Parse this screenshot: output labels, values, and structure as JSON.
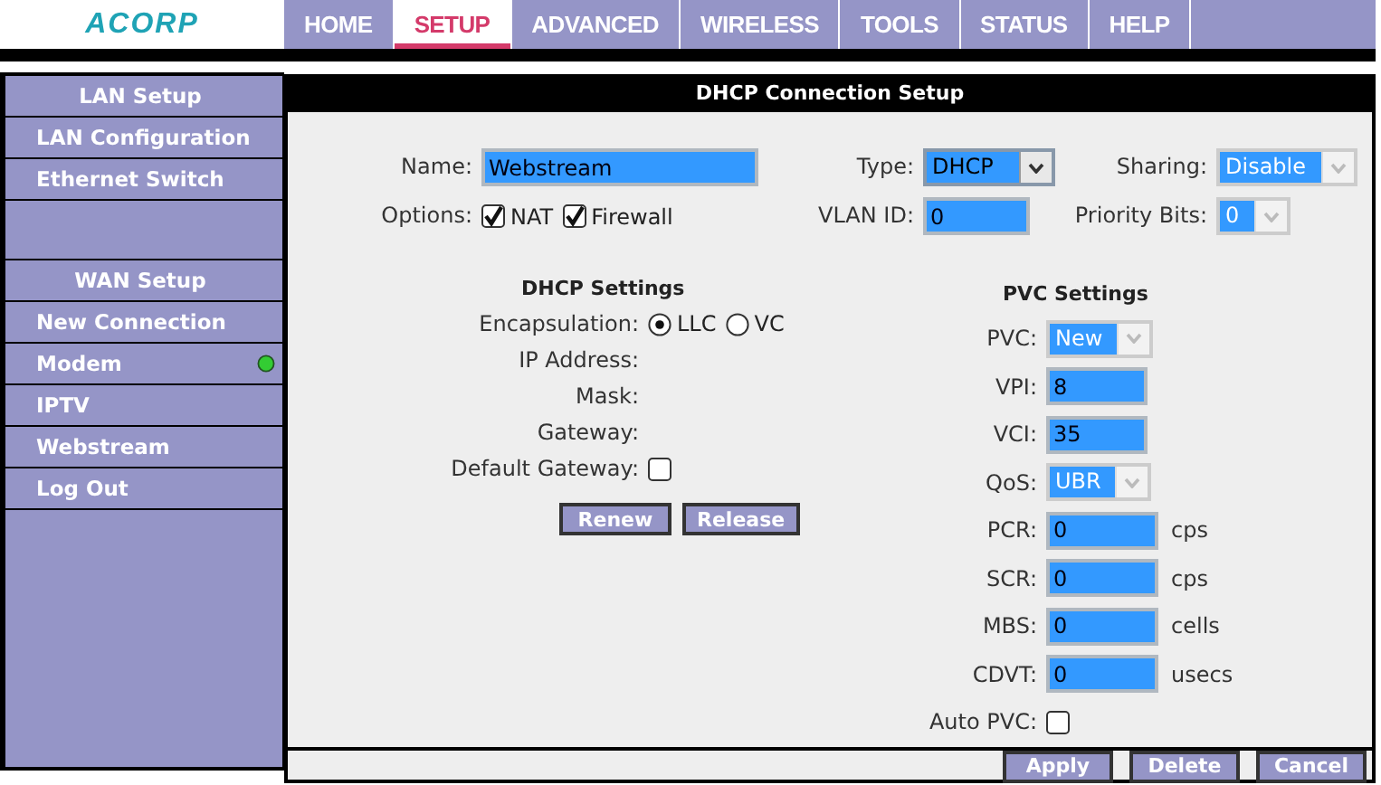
{
  "logo": {
    "text": "ACORP"
  },
  "tabs": [
    {
      "label": "HOME",
      "selected": false
    },
    {
      "label": "SETUP",
      "selected": true
    },
    {
      "label": "ADVANCED",
      "selected": false
    },
    {
      "label": "WIRELESS",
      "selected": false
    },
    {
      "label": "TOOLS",
      "selected": false
    },
    {
      "label": "STATUS",
      "selected": false
    },
    {
      "label": "HELP",
      "selected": false
    }
  ],
  "sidebar": {
    "items": [
      {
        "kind": "header",
        "label": "LAN Setup"
      },
      {
        "kind": "link",
        "label": "LAN Configuration"
      },
      {
        "kind": "link",
        "label": "Ethernet Switch"
      },
      {
        "kind": "spacer"
      },
      {
        "kind": "header",
        "label": "WAN Setup"
      },
      {
        "kind": "link",
        "label": "New Connection"
      },
      {
        "kind": "link",
        "label": "Modem",
        "color": "#33cc33"
      },
      {
        "kind": "link",
        "label": "IPTV"
      },
      {
        "kind": "link",
        "label": "Webstream"
      },
      {
        "kind": "link",
        "label": "Log Out"
      }
    ]
  },
  "panel": {
    "title": "DHCP Connection Setup",
    "rows": [
      {
        "fields": [
          {
            "kind": "input",
            "label": "Name:",
            "value": "Webstream"
          },
          {
            "kind": "select",
            "label": "Type:",
            "value": "DHCP",
            "disabled": false
          },
          {
            "kind": "select",
            "label": "Sharing:",
            "value": "Disable",
            "disabled": true
          }
        ]
      },
      {
        "fields": [
          {
            "kind": "checks",
            "label": "Options:",
            "checks": [
              {
                "label": "NAT",
                "checked": true
              },
              {
                "label": "Firewall",
                "checked": true
              }
            ]
          },
          {
            "kind": "input",
            "label": "VLAN ID:",
            "value": "0"
          },
          {
            "kind": "select",
            "label": "Priority Bits:",
            "value": "0",
            "disabled": true
          }
        ]
      }
    ],
    "dhcp": {
      "title": "DHCP Settings",
      "rows": [
        {
          "kind": "radio",
          "label": "Encapsulation:",
          "options": [
            {
              "label": "LLC",
              "selected": true
            },
            {
              "label": "VC",
              "selected": false
            }
          ]
        },
        {
          "kind": "text",
          "label": "IP Address:"
        },
        {
          "kind": "text",
          "label": "Mask:"
        },
        {
          "kind": "text",
          "label": "Gateway:"
        },
        {
          "kind": "checkbox",
          "label": "Default Gateway:",
          "checked": false
        }
      ],
      "buttons": [
        "Renew",
        "Release"
      ]
    },
    "pvc": {
      "title": "PVC Settings",
      "rows": [
        {
          "kind": "select",
          "label": "PVC:",
          "value": "New",
          "disabled": true
        },
        {
          "kind": "input",
          "label": "VPI:",
          "value": "8"
        },
        {
          "kind": "input",
          "label": "VCI:",
          "value": "35"
        },
        {
          "kind": "select",
          "label": "QoS:",
          "value": "UBR",
          "disabled": true
        },
        {
          "kind": "input",
          "label": "PCR:",
          "value": "0",
          "unit": "cps"
        },
        {
          "kind": "input",
          "label": "SCR:",
          "value": "0",
          "unit": "cps"
        },
        {
          "kind": "input",
          "label": "MBS:",
          "value": "0",
          "unit": "cells"
        },
        {
          "kind": "input",
          "label": "CDVT:",
          "value": "0",
          "unit": "usecs"
        },
        {
          "kind": "checkbox",
          "label": "Auto PVC:",
          "checked": false
        }
      ]
    },
    "buttons": [
      "Apply",
      "Delete",
      "Cancel"
    ]
  }
}
